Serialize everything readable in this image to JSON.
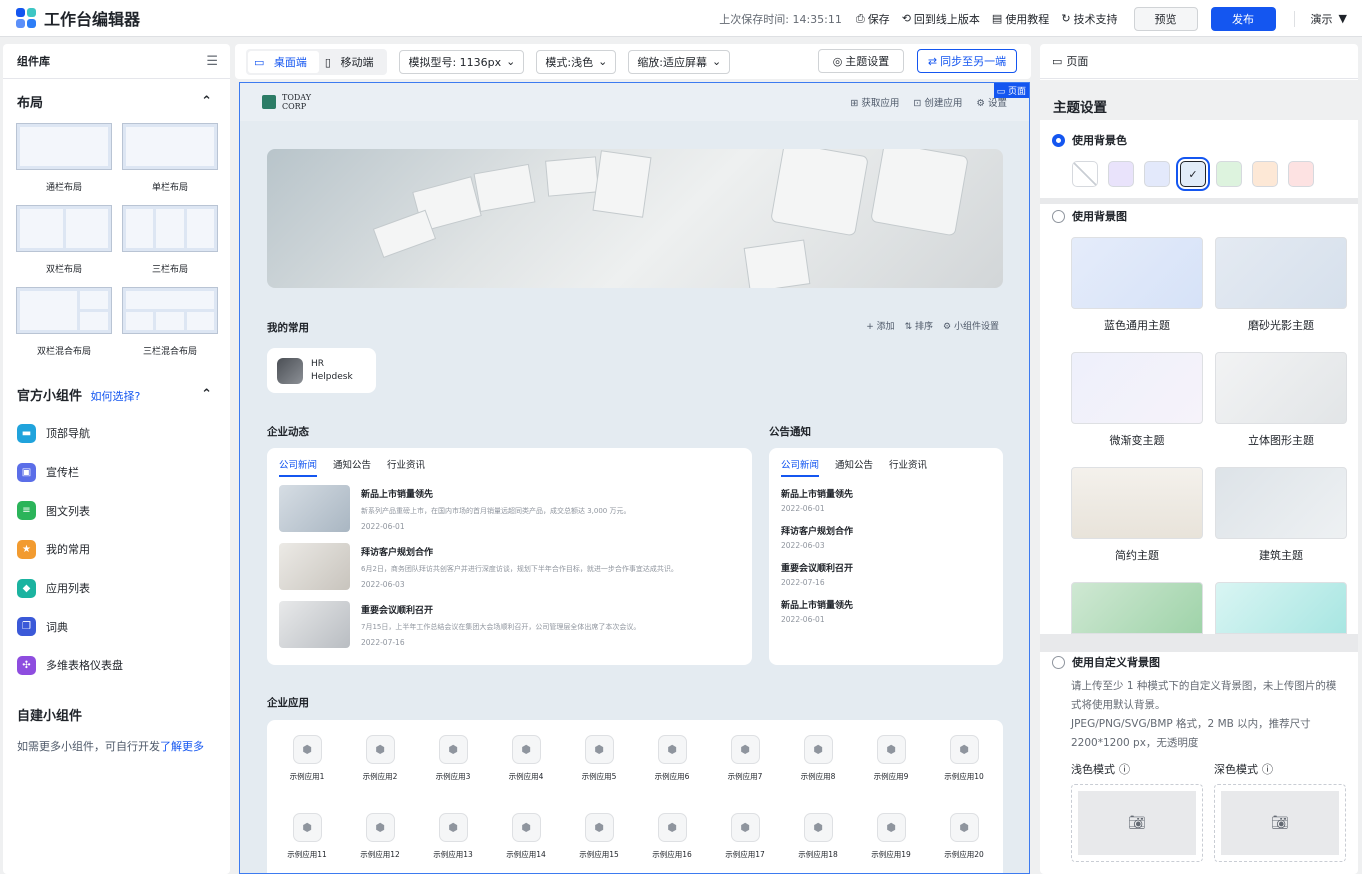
{
  "app": {
    "title": "工作台编辑器",
    "last_saved": "上次保存时间: 14:35:11",
    "save": "保存",
    "revert": "回到线上版本",
    "tutorial": "使用教程",
    "support": "技术支持",
    "preview": "预览",
    "publish": "发布",
    "demo": "演示",
    "brand_colors": [
      "#1456f0",
      "#3ec6c4",
      "#5b8ff9",
      "#2d7ef7"
    ]
  },
  "left": {
    "header": "组件库",
    "layout_section": "布局",
    "layouts": [
      "通栏布局",
      "单栏布局",
      "双栏布局",
      "三栏布局",
      "双栏混合布局",
      "三栏混合布局"
    ],
    "official_section": "官方小组件",
    "how_to_choose": "如何选择?",
    "widgets": [
      {
        "label": "顶部导航",
        "color": "#20a3dc",
        "icon": "nav-icon"
      },
      {
        "label": "宣传栏",
        "color": "#5b6ee8",
        "icon": "image-icon"
      },
      {
        "label": "图文列表",
        "color": "#2bb45a",
        "icon": "list-icon"
      },
      {
        "label": "我的常用",
        "color": "#f29b30",
        "icon": "star-icon"
      },
      {
        "label": "应用列表",
        "color": "#1bb3a0",
        "icon": "apps-icon"
      },
      {
        "label": "词典",
        "color": "#3b59d8",
        "icon": "book-icon"
      },
      {
        "label": "多维表格仪表盘",
        "color": "#8e4ddf",
        "icon": "dashboard-icon"
      }
    ],
    "custom_section": "自建小组件",
    "custom_desc": "如需更多小组件，可自行开发",
    "learn_more": "了解更多"
  },
  "toolbar": {
    "desktop": "桌面端",
    "mobile": "移动端",
    "model": "模拟型号: 1136px",
    "mode": "模式:浅色",
    "zoom": "缩放:适应屏幕",
    "theme_settings": "主题设置",
    "sync": "同步至另一端"
  },
  "canvas": {
    "page_tag": "页面",
    "corp_line1": "TODAY",
    "corp_line2": "CORP",
    "get_apps": "获取应用",
    "create_app": "创建应用",
    "settings": "设置",
    "favorites_title": "我的常用",
    "add": "+ 添加",
    "sort": "排序",
    "widget_settings": "小组件设置",
    "hr_line1": "HR",
    "hr_line2": "Helpdesk",
    "news_title": "企业动态",
    "news_tabs": [
      "公司新闻",
      "通知公告",
      "行业资讯"
    ],
    "news": [
      {
        "title": "新品上市销量领先",
        "desc": "新系列产品重磅上市，在国内市场的首月销量远超同类产品，成交总额达 3,000 万元。",
        "date": "2022-06-01"
      },
      {
        "title": "拜访客户规划合作",
        "desc": "6月2日，商务团队拜访共创客户并进行深度访谈，规划下半年合作目标，就进一步合作事宜达成共识。",
        "date": "2022-06-03"
      },
      {
        "title": "重要会议顺利召开",
        "desc": "7月15日，上半年工作总结会议在集团大会场顺利召开，公司管理层全体出席了本次会议。",
        "date": "2022-07-16"
      }
    ],
    "announce_title": "公告通知",
    "announce_tabs": [
      "公司新闻",
      "通知公告",
      "行业资讯"
    ],
    "announcements": [
      {
        "title": "新品上市销量领先",
        "date": "2022-06-01"
      },
      {
        "title": "拜访客户规划合作",
        "date": "2022-06-03"
      },
      {
        "title": "重要会议顺利召开",
        "date": "2022-07-16"
      },
      {
        "title": "新品上市销量领先",
        "date": "2022-06-01"
      }
    ],
    "apps_title": "企业应用",
    "apps": [
      "示例应用1",
      "示例应用2",
      "示例应用3",
      "示例应用4",
      "示例应用5",
      "示例应用6",
      "示例应用7",
      "示例应用8",
      "示例应用9",
      "示例应用10",
      "示例应用11",
      "示例应用12",
      "示例应用13",
      "示例应用14",
      "示例应用15",
      "示例应用16",
      "示例应用17",
      "示例应用18",
      "示例应用19",
      "示例应用20"
    ]
  },
  "right": {
    "header": "页面",
    "title": "主题设置",
    "use_bg_color": "使用背景色",
    "swatches": [
      "transparent",
      "#e9e3fb",
      "#e3e9fb",
      "#e1ecf8",
      "#ddf3de",
      "#fde8d6",
      "#fde2e2"
    ],
    "selected_swatch": 3,
    "use_bg_image": "使用背景图",
    "themes": [
      {
        "name": "蓝色通用主题",
        "bg": "linear-gradient(135deg,#e5ecfa,#d6e2f8)"
      },
      {
        "name": "磨砂光影主题",
        "bg": "linear-gradient(135deg,#e4eaf2,#d6e0ec)"
      },
      {
        "name": "微渐变主题",
        "bg": "linear-gradient(135deg,#eef0fb,#f6f3fa)"
      },
      {
        "name": "立体图形主题",
        "bg": "linear-gradient(135deg,#f2f3f4,#e2e5e7)"
      },
      {
        "name": "简约主题",
        "bg": "linear-gradient(180deg,#f4f1ec,#e8e3da)"
      },
      {
        "name": "建筑主题",
        "bg": "linear-gradient(135deg,#dde3e8,#eef1f3)"
      },
      {
        "name": "",
        "bg": "linear-gradient(135deg,#cfe8d3,#9fd3a9)"
      },
      {
        "name": "",
        "bg": "linear-gradient(135deg,#d9f5f3,#a8e6e2)"
      }
    ],
    "use_custom_bg": "使用自定义背景图",
    "custom_hint1": "请上传至少 1 种模式下的自定义背景图，未上传图片的模式将使用默认背景。",
    "custom_hint2": "JPEG/PNG/SVG/BMP 格式，2 MB 以内，推荐尺寸 2200*1200 px，无透明度",
    "light_mode": "浅色模式",
    "dark_mode": "深色模式"
  }
}
